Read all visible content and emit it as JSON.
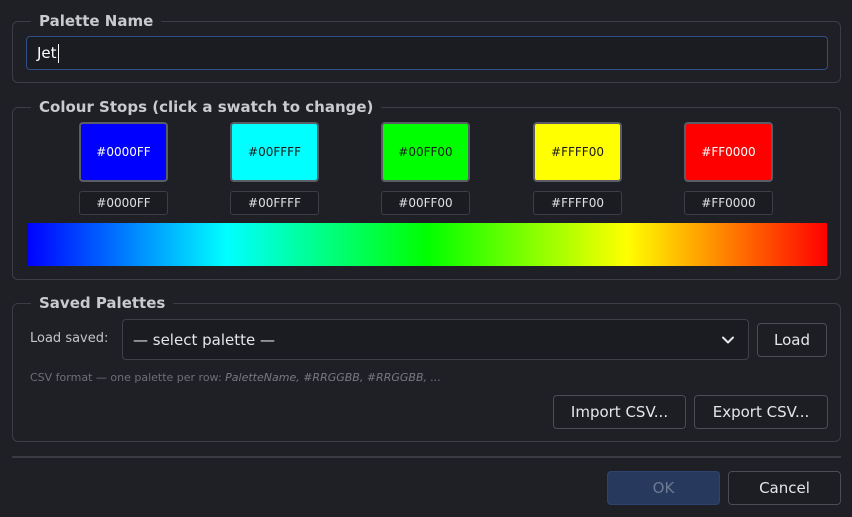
{
  "palette_name": {
    "title": "Palette Name",
    "value": "Jet"
  },
  "colour_stops": {
    "title": "Colour Stops  (click a swatch to change)",
    "stops": [
      {
        "hex": "#0000FF",
        "color": "#0000FF",
        "text_color": "#ffffff"
      },
      {
        "hex": "#00FFFF",
        "color": "#00FFFF",
        "text_color": "#1a1a1a"
      },
      {
        "hex": "#00FF00",
        "color": "#00FF00",
        "text_color": "#1a1a1a"
      },
      {
        "hex": "#FFFF00",
        "color": "#FFFF00",
        "text_color": "#1a1a1a"
      },
      {
        "hex": "#FF0000",
        "color": "#FF0000",
        "text_color": "#ffffff"
      }
    ]
  },
  "saved_palettes": {
    "title": "Saved Palettes",
    "load_label": "Load saved:",
    "selected": "— select palette —",
    "load_button": "Load",
    "hint_prefix": "CSV format — one palette per row: ",
    "hint_format": "PaletteName, #RRGGBB, #RRGGBB, ...",
    "import_button": "Import CSV...",
    "export_button": "Export CSV..."
  },
  "footer": {
    "ok_button": "OK",
    "cancel_button": "Cancel"
  },
  "colors": {
    "background": "#1f2026",
    "border": "#3c3e46",
    "accent": "#2f4f86",
    "primary_button": "#273a5e"
  }
}
